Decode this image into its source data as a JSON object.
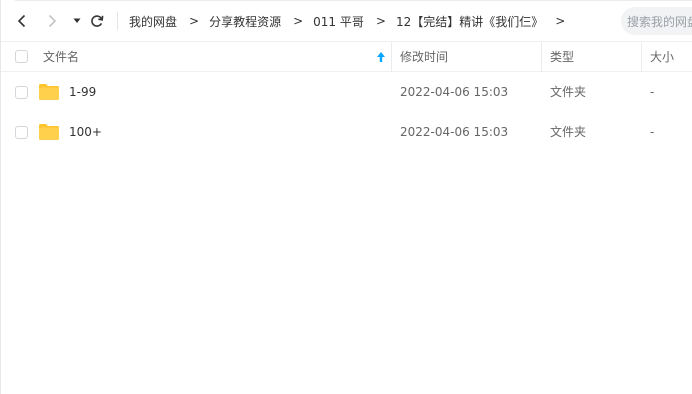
{
  "nav": {
    "breadcrumbs": [
      "我的网盘",
      "分享教程资源",
      "011 平哥",
      "12【完结】精讲《我们仨》"
    ],
    "separator": ">",
    "search_placeholder": "搜索我的网盘"
  },
  "table": {
    "headers": {
      "name": "文件名",
      "modified": "修改时间",
      "type": "类型",
      "size": "大小"
    },
    "rows": [
      {
        "name": "1-99",
        "modified": "2022-04-06 15:03",
        "type": "文件夹",
        "size": "-"
      },
      {
        "name": "100+",
        "modified": "2022-04-06 15:03",
        "type": "文件夹",
        "size": "-"
      }
    ]
  },
  "colors": {
    "accent": "#06a7ff",
    "folder": "#ffd04b",
    "folder_tab": "#ffc52f"
  }
}
